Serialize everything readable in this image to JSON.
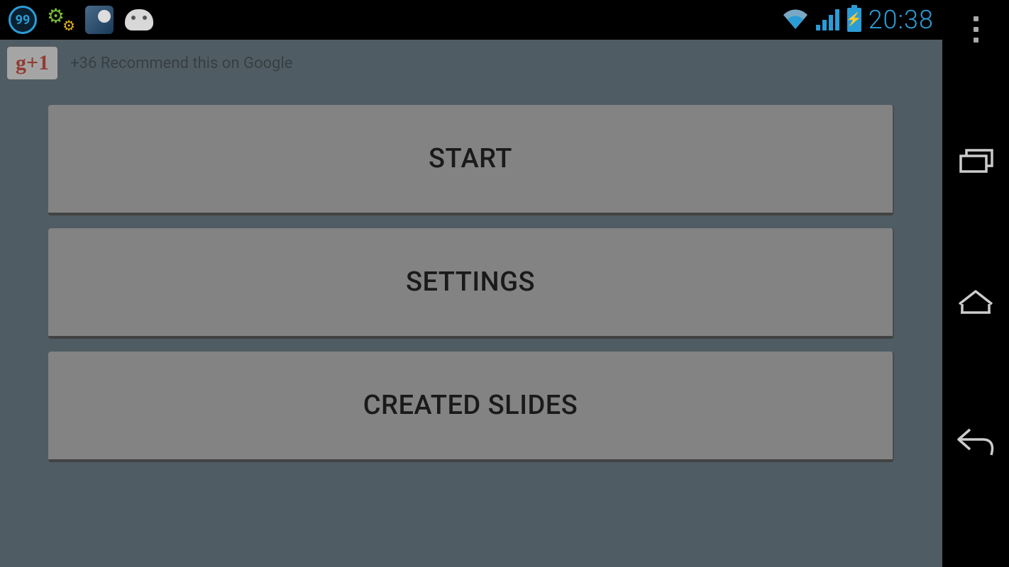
{
  "statusBar": {
    "badge99": "99",
    "clock": "20:38"
  },
  "topRow": {
    "gplusLabel": "g+1",
    "recommendText": "+36 Recommend this on Google"
  },
  "buttons": {
    "start": "START",
    "settings": "SETTINGS",
    "createdSlides": "CREATED SLIDES"
  }
}
